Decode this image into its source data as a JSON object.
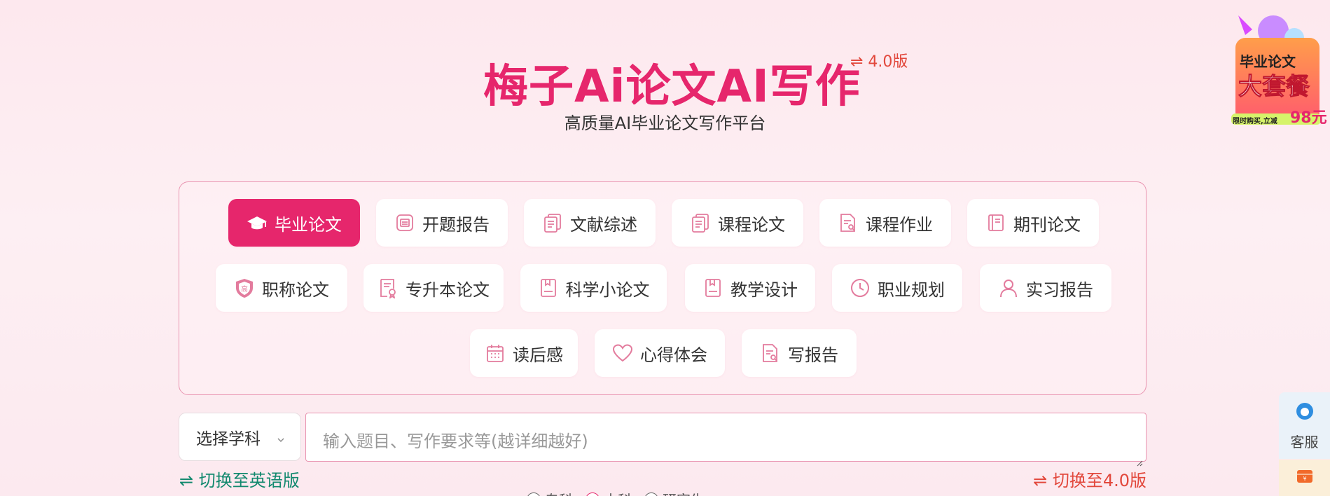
{
  "header": {
    "title": "梅子Ai论文AI写作",
    "version": "⇌ 4.0版",
    "subtitle": "高质量AI毕业论文写作平台"
  },
  "promo": {
    "line1": "毕业论文",
    "line2": "大套餐",
    "line3": "限时购买,立减",
    "price": "98元"
  },
  "categories": [
    {
      "label": "毕业论文",
      "icon": "graduation-cap-icon",
      "active": true
    },
    {
      "label": "开题报告",
      "icon": "report-icon"
    },
    {
      "label": "文献综述",
      "icon": "documents-icon"
    },
    {
      "label": "课程论文",
      "icon": "documents-icon"
    },
    {
      "label": "课程作业",
      "icon": "document-search-icon"
    },
    {
      "label": "期刊论文",
      "icon": "journal-icon"
    },
    {
      "label": "职称论文",
      "icon": "shield-badge-icon"
    },
    {
      "label": "专升本论文",
      "icon": "certificate-icon"
    },
    {
      "label": "科学小论文",
      "icon": "book-icon"
    },
    {
      "label": "教学设计",
      "icon": "book-icon"
    },
    {
      "label": "职业规划",
      "icon": "clock-icon"
    },
    {
      "label": "实习报告",
      "icon": "user-icon"
    },
    {
      "label": "读后感",
      "icon": "calendar-icon"
    },
    {
      "label": "心得体会",
      "icon": "heart-icon"
    },
    {
      "label": "写报告",
      "icon": "document-search-icon"
    }
  ],
  "form": {
    "subject_label": "选择学科",
    "topic_placeholder": "输入题目、写作要求等(越详细越好)",
    "switch_english": "⇌ 切换至英语版",
    "switch_v4": "⇌ 切换至4.0版"
  },
  "radios": [
    {
      "label": "专科"
    },
    {
      "label": "本科",
      "selected": true
    },
    {
      "label": "研究生"
    }
  ],
  "side": {
    "service_label": "客服",
    "coupon_icon": "coupon-icon"
  },
  "colors": {
    "brand": "#e6266c",
    "version_red": "#e2483c",
    "switch_green": "#12896e"
  }
}
